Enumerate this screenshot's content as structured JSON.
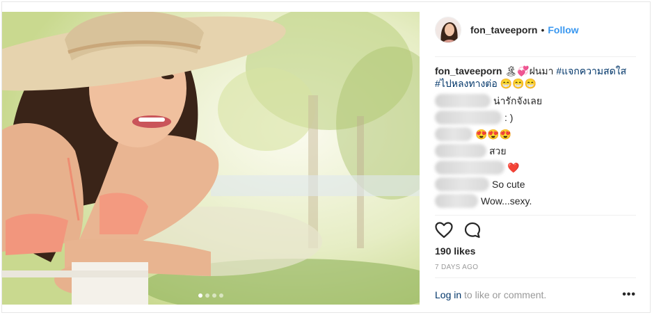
{
  "header": {
    "username": "fon_taveeporn",
    "separator": "•",
    "follow_label": "Follow"
  },
  "caption": {
    "username": "fon_taveeporn",
    "emoji_1": "🏝💞",
    "text": "ฝนมา",
    "hashtag_1": "#แจกความสดใส",
    "hashtag_2": "#ไปหลงทางต่อ",
    "emoji_2": "😁😁😁"
  },
  "comments": [
    {
      "text": "น่ารักจังเลย"
    },
    {
      "text": ": )"
    },
    {
      "text": "😍😍😍"
    },
    {
      "text": "สวย"
    },
    {
      "text": "❤️"
    },
    {
      "text": "So cute"
    },
    {
      "text": "Wow...sexy."
    }
  ],
  "likes": "190 likes",
  "time": "7 days ago",
  "footer": {
    "login": "Log in",
    "rest": " to like or comment.",
    "more": "•••"
  },
  "carousel": {
    "current": 1,
    "total": 4
  },
  "icons": {
    "like": "heart-icon",
    "comment": "comment-bubble-icon",
    "more": "more-options-icon"
  },
  "colors": {
    "link": "#3897f0",
    "hashtag": "#003569",
    "muted": "#999999",
    "border": "#e6e6e6"
  }
}
